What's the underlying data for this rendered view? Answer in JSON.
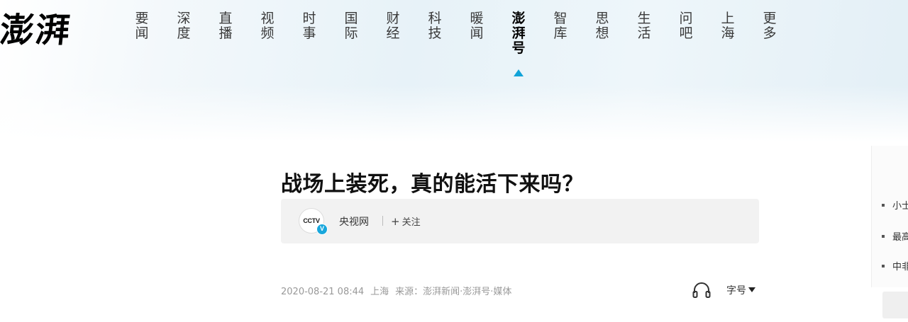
{
  "logo": {
    "text": "澎湃"
  },
  "nav": {
    "items": [
      {
        "label": "要闻"
      },
      {
        "label": "深度"
      },
      {
        "label": "直播"
      },
      {
        "label": "视频"
      },
      {
        "label": "时事"
      },
      {
        "label": "国际"
      },
      {
        "label": "财经"
      },
      {
        "label": "科技"
      },
      {
        "label": "暖闻"
      },
      {
        "label": "澎湃号",
        "active": true
      },
      {
        "label": "智库"
      },
      {
        "label": "思想"
      },
      {
        "label": "生活"
      },
      {
        "label": "问吧"
      },
      {
        "label": "上海"
      },
      {
        "label": "更多"
      }
    ],
    "active_indicator_color": "#11a3d8"
  },
  "article": {
    "title": "战场上装死，真的能活下来吗？",
    "author": {
      "name": "央视网",
      "avatar_text": "CCTV",
      "verified_badge": "V",
      "follow_label": "关注"
    },
    "meta": {
      "datetime": "2020-08-21 08:44",
      "location": "上海",
      "source": "来源：澎湃新闻·澎湃号·媒体"
    },
    "tools": {
      "audio_icon": "headphone-icon",
      "font_size_label": "字号"
    }
  },
  "sidebar": {
    "items": [
      {
        "label": "小士"
      },
      {
        "label": "最高"
      },
      {
        "label": "中非"
      }
    ]
  }
}
